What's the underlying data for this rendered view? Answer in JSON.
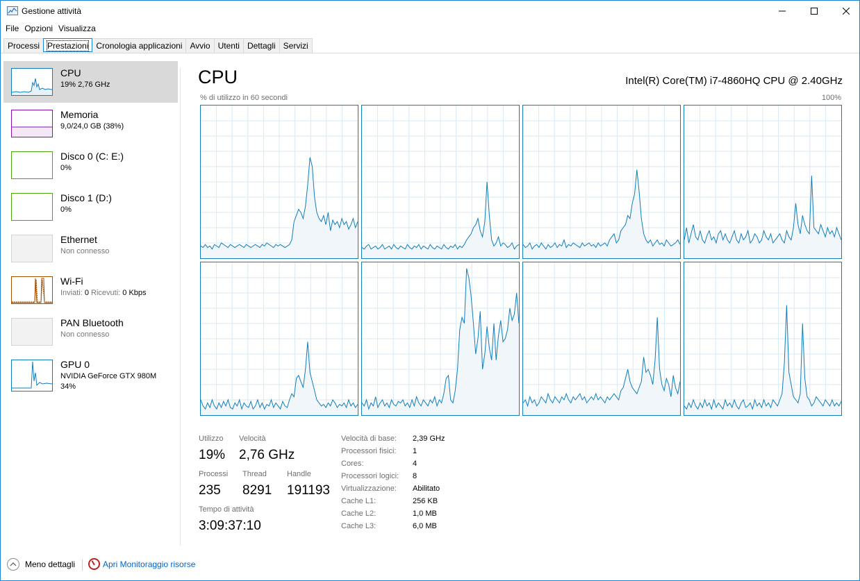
{
  "window": {
    "title": "Gestione attività"
  },
  "menu": {
    "items": [
      "File",
      "Opzioni",
      "Visualizza"
    ]
  },
  "tabs": [
    "Processi",
    "Prestazioni",
    "Cronologia applicazioni",
    "Avvio",
    "Utenti",
    "Dettagli",
    "Servizi"
  ],
  "active_tab": "Prestazioni",
  "sidebar": {
    "items": [
      {
        "title": "CPU",
        "sub": "19% 2,76 GHz",
        "color": "#117dbb"
      },
      {
        "title": "Memoria",
        "sub": "9,0/24,0 GB (38%)",
        "color": "#8b12ae"
      },
      {
        "title": "Disco 0 (C: E:)",
        "sub": "0%",
        "color": "#4da60c"
      },
      {
        "title": "Disco 1 (D:)",
        "sub": "0%",
        "color": "#4da60c"
      },
      {
        "title": "Ethernet",
        "sub": "Non connesso",
        "color": "#a7a7a7"
      },
      {
        "title": "Wi-Fi",
        "sub_prefix_1": "Inviati:",
        "sub_val_1": "0",
        "sub_prefix_2": "Ricevuti:",
        "sub_val_2": "0 Kbps",
        "color": "#a74f01"
      },
      {
        "title": "PAN Bluetooth",
        "sub": "Non connesso",
        "color": "#a7a7a7"
      },
      {
        "title": "GPU 0",
        "sub": "NVIDIA GeForce GTX 980M",
        "sub2": "34%",
        "color": "#117dbb"
      }
    ]
  },
  "main": {
    "title": "CPU",
    "model": "Intel(R) Core(TM) i7-4860HQ CPU @ 2.40GHz",
    "graph_label_left": "% di utilizzo in 60 secondi",
    "graph_label_right": "100%",
    "stats": {
      "utilizzo_label": "Utilizzo",
      "utilizzo_value": "19%",
      "velocita_label": "Velocità",
      "velocita_value": "2,76 GHz",
      "processi_label": "Processi",
      "processi_value": "235",
      "thread_label": "Thread",
      "thread_value": "8291",
      "handle_label": "Handle",
      "handle_value": "191193",
      "tempo_label": "Tempo di attività",
      "tempo_value": "3:09:37:10"
    },
    "specs": [
      {
        "label": "Velocità di base:",
        "value": "2,39 GHz"
      },
      {
        "label": "Processori fisici:",
        "value": "1"
      },
      {
        "label": "Cores:",
        "value": "4"
      },
      {
        "label": "Processori logici:",
        "value": "8"
      },
      {
        "label": "Virtualizzazione:",
        "value": "Abilitato"
      },
      {
        "label": "Cache L1:",
        "value": "256 KB"
      },
      {
        "label": "Cache L2:",
        "value": "1,0 MB"
      },
      {
        "label": "Cache L3:",
        "value": "6,0 MB"
      }
    ]
  },
  "footer": {
    "less_details": "Meno dettagli",
    "monitor_link": "Apri Monitoraggio risorse"
  },
  "chart_data": {
    "type": "area",
    "title": "% di utilizzo in 60 secondi",
    "ylim": [
      0,
      100
    ],
    "grid": true,
    "color": "#117dbb",
    "series": [
      {
        "values": [
          8,
          7,
          9,
          7,
          8,
          6,
          9,
          8,
          7,
          10,
          9,
          8,
          7,
          9,
          8,
          7,
          8,
          9,
          8,
          7,
          9,
          8,
          7,
          8,
          9,
          8,
          7,
          9,
          8,
          10,
          9,
          8,
          7,
          9,
          8,
          9,
          8,
          7,
          8,
          9,
          12,
          24,
          28,
          32,
          30,
          26,
          34,
          48,
          66,
          60,
          40,
          30,
          26,
          24,
          28,
          22,
          30,
          18,
          25,
          22,
          24,
          20,
          26,
          22,
          24,
          19,
          22,
          26,
          20,
          24
        ]
      },
      {
        "values": [
          7,
          6,
          8,
          9,
          6,
          7,
          8,
          6,
          7,
          9,
          6,
          7,
          8,
          6,
          9,
          7,
          6,
          8,
          7,
          6,
          9,
          7,
          6,
          8,
          7,
          9,
          6,
          8,
          7,
          6,
          9,
          7,
          6,
          8,
          7,
          6,
          9,
          7,
          6,
          8,
          7,
          9,
          6,
          8,
          7,
          9,
          12,
          14,
          16,
          20,
          22,
          26,
          18,
          14,
          24,
          50,
          28,
          12,
          8,
          10,
          14,
          8,
          10,
          9,
          7,
          8,
          10,
          6,
          8,
          9
        ]
      },
      {
        "values": [
          9,
          7,
          8,
          10,
          6,
          8,
          9,
          7,
          10,
          8,
          6,
          9,
          7,
          8,
          10,
          7,
          9,
          8,
          12,
          7,
          9,
          8,
          10,
          9,
          8,
          7,
          10,
          8,
          9,
          10,
          8,
          9,
          7,
          10,
          8,
          9,
          10,
          8,
          12,
          14,
          16,
          10,
          12,
          18,
          20,
          22,
          28,
          26,
          36,
          42,
          58,
          44,
          26,
          16,
          12,
          10,
          12,
          8,
          10,
          12,
          9,
          10,
          8,
          12,
          10,
          8,
          9,
          10,
          12,
          9
        ]
      },
      {
        "values": [
          12,
          20,
          10,
          16,
          22,
          14,
          12,
          18,
          12,
          10,
          15,
          18,
          12,
          14,
          10,
          16,
          18,
          12,
          16,
          12,
          10,
          14,
          18,
          12,
          10,
          16,
          12,
          14,
          18,
          10,
          12,
          16,
          14,
          10,
          12,
          18,
          14,
          12,
          16,
          10,
          12,
          14,
          16,
          12,
          10,
          18,
          14,
          12,
          20,
          36,
          22,
          16,
          28,
          22,
          18,
          16,
          54,
          20,
          18,
          16,
          22,
          18,
          14,
          20,
          16,
          18,
          14,
          20,
          16,
          12
        ]
      },
      {
        "values": [
          10,
          6,
          4,
          8,
          5,
          10,
          6,
          4,
          8,
          5,
          9,
          6,
          10,
          5,
          4,
          8,
          6,
          10,
          4,
          8,
          6,
          5,
          9,
          4,
          6,
          10,
          5,
          8,
          4,
          7,
          6,
          10,
          5,
          8,
          6,
          4,
          9,
          6,
          5,
          10,
          14,
          12,
          24,
          26,
          22,
          18,
          30,
          48,
          28,
          22,
          16,
          10,
          8,
          6,
          7,
          5,
          8,
          6,
          10,
          8,
          5,
          7,
          6,
          8,
          5,
          10,
          6,
          8,
          5,
          7
        ]
      },
      {
        "values": [
          8,
          6,
          10,
          4,
          8,
          6,
          12,
          5,
          8,
          10,
          6,
          8,
          5,
          10,
          7,
          6,
          9,
          8,
          10,
          6,
          8,
          5,
          10,
          6,
          12,
          8,
          6,
          10,
          8,
          6,
          10,
          8,
          12,
          6,
          10,
          8,
          14,
          24,
          26,
          10,
          8,
          16,
          30,
          56,
          64,
          60,
          96,
          90,
          78,
          60,
          40,
          50,
          68,
          30,
          40,
          58,
          44,
          36,
          60,
          36,
          52,
          62,
          48,
          50,
          56,
          70,
          62,
          66,
          80,
          60
        ]
      },
      {
        "values": [
          8,
          10,
          6,
          12,
          8,
          10,
          6,
          8,
          12,
          10,
          8,
          14,
          10,
          8,
          12,
          10,
          8,
          12,
          10,
          14,
          10,
          8,
          12,
          10,
          12,
          14,
          10,
          12,
          8,
          10,
          12,
          10,
          14,
          10,
          12,
          10,
          8,
          12,
          10,
          12,
          14,
          12,
          10,
          16,
          18,
          24,
          30,
          22,
          18,
          16,
          14,
          18,
          22,
          38,
          28,
          30,
          26,
          20,
          36,
          64,
          30,
          20,
          16,
          24,
          20,
          12,
          26,
          18,
          14,
          22
        ]
      },
      {
        "values": [
          6,
          4,
          8,
          5,
          10,
          6,
          4,
          8,
          5,
          10,
          6,
          8,
          4,
          10,
          5,
          8,
          6,
          4,
          10,
          6,
          8,
          5,
          10,
          6,
          4,
          8,
          10,
          5,
          6,
          8,
          4,
          10,
          6,
          8,
          5,
          10,
          6,
          8,
          5,
          10,
          8,
          6,
          10,
          14,
          34,
          72,
          28,
          20,
          12,
          10,
          8,
          14,
          60,
          24,
          12,
          10,
          6,
          8,
          12,
          10,
          8,
          6,
          10,
          8,
          6,
          10,
          6,
          8,
          6,
          9
        ]
      }
    ]
  }
}
